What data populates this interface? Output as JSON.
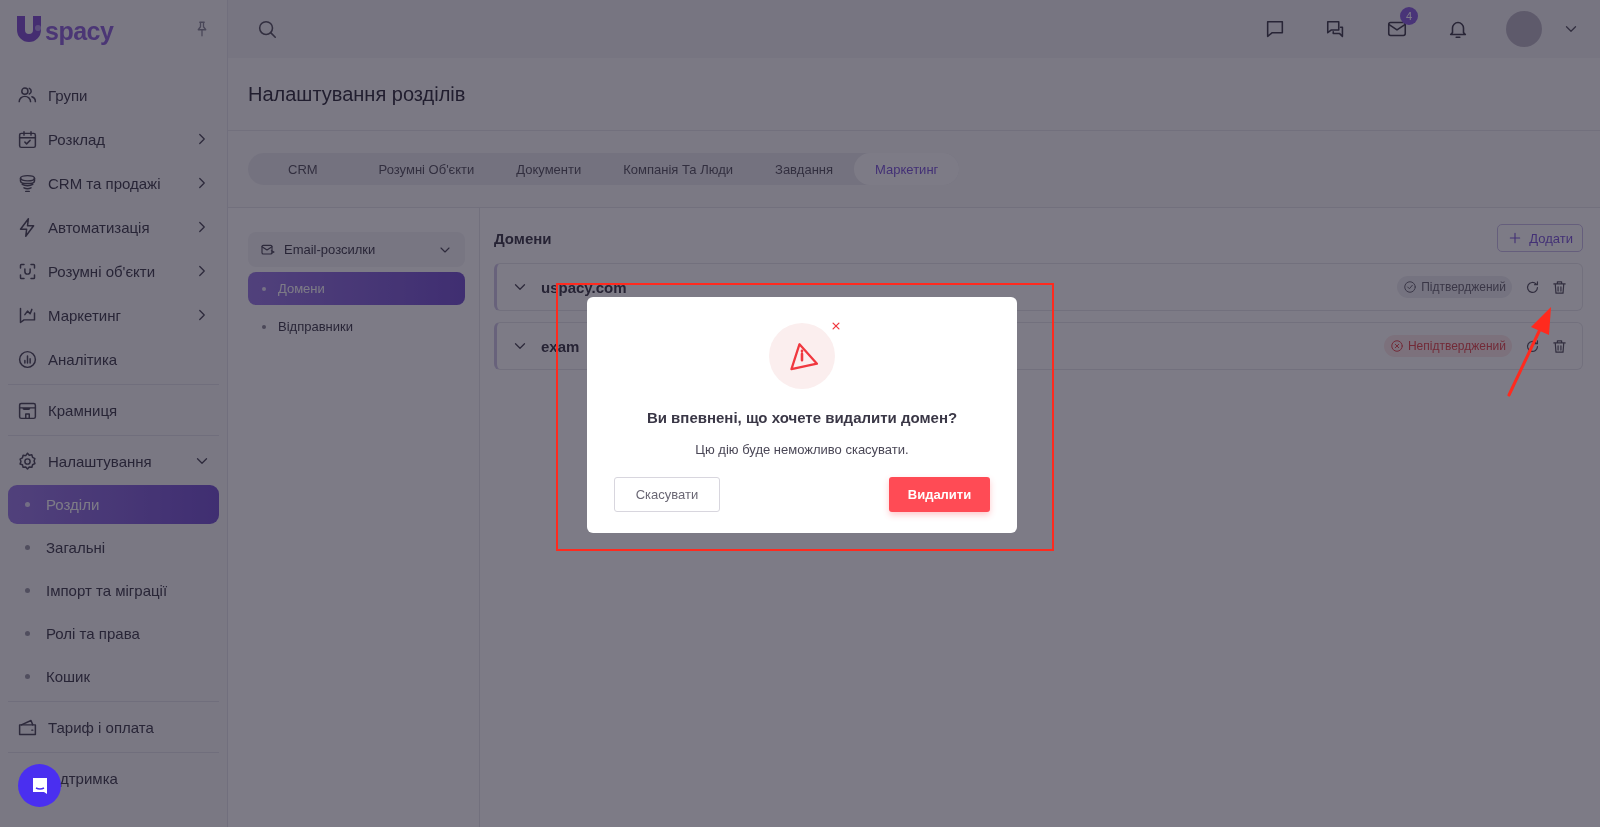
{
  "logo": {
    "text": "spacy"
  },
  "sidebar": {
    "sections": [
      {
        "items": [
          {
            "kind": "link",
            "label": "Групи"
          },
          {
            "kind": "group",
            "label": "Розклад",
            "expanded": false
          },
          {
            "kind": "group",
            "label": "CRM та продажі",
            "expanded": false
          },
          {
            "kind": "group",
            "label": "Автоматизація",
            "expanded": false
          },
          {
            "kind": "group",
            "label": "Розумні об'єкти",
            "expanded": false
          },
          {
            "kind": "group",
            "label": "Маркетинг",
            "expanded": false
          },
          {
            "kind": "link",
            "label": "Аналітика"
          }
        ]
      },
      {
        "items": [
          {
            "kind": "link",
            "label": "Крамниця"
          }
        ]
      },
      {
        "items": [
          {
            "kind": "group",
            "label": "Налаштування",
            "expanded": true,
            "children": [
              {
                "label": "Розділи",
                "selected": true
              },
              {
                "label": "Загальні",
                "selected": false
              },
              {
                "label": "Імпорт та міграції",
                "selected": false
              },
              {
                "label": "Ролі та права",
                "selected": false
              },
              {
                "label": "Кошик",
                "selected": false
              }
            ]
          }
        ]
      },
      {
        "items": [
          {
            "kind": "link",
            "label": "Тариф і оплата"
          }
        ]
      },
      {
        "items": [
          {
            "kind": "link",
            "label": "дтримка"
          }
        ]
      }
    ]
  },
  "header": {
    "mail_badge": "4"
  },
  "page": {
    "title": "Налаштування розділів",
    "tabs": [
      {
        "label": "CRM",
        "selected": false
      },
      {
        "label": "Розумні Об'єкти",
        "selected": false
      },
      {
        "label": "Документи",
        "selected": false
      },
      {
        "label": "Компанія Та Люди",
        "selected": false
      },
      {
        "label": "Завдання",
        "selected": false
      },
      {
        "label": "Маркетинг",
        "selected": true
      }
    ],
    "submenu": {
      "label": "Email-розсилки",
      "expanded": true,
      "items": [
        {
          "label": "Домени",
          "selected": true
        },
        {
          "label": "Відправники",
          "selected": false
        }
      ]
    },
    "content": {
      "title": "Домени",
      "add_button": "Додати",
      "domains": [
        {
          "name": "uspacy.com",
          "expanded": false,
          "verified": true,
          "status": "Підтверджений"
        },
        {
          "name": "exam",
          "expanded": false,
          "verified": false,
          "status": "Непідтверджений"
        }
      ]
    }
  },
  "dialog": {
    "title": "Ви впевнені, що хочете видалити домен?",
    "message": "Цю дію буде неможливо скасувати.",
    "cancel": "Скасувати",
    "confirm": "Видалити"
  }
}
